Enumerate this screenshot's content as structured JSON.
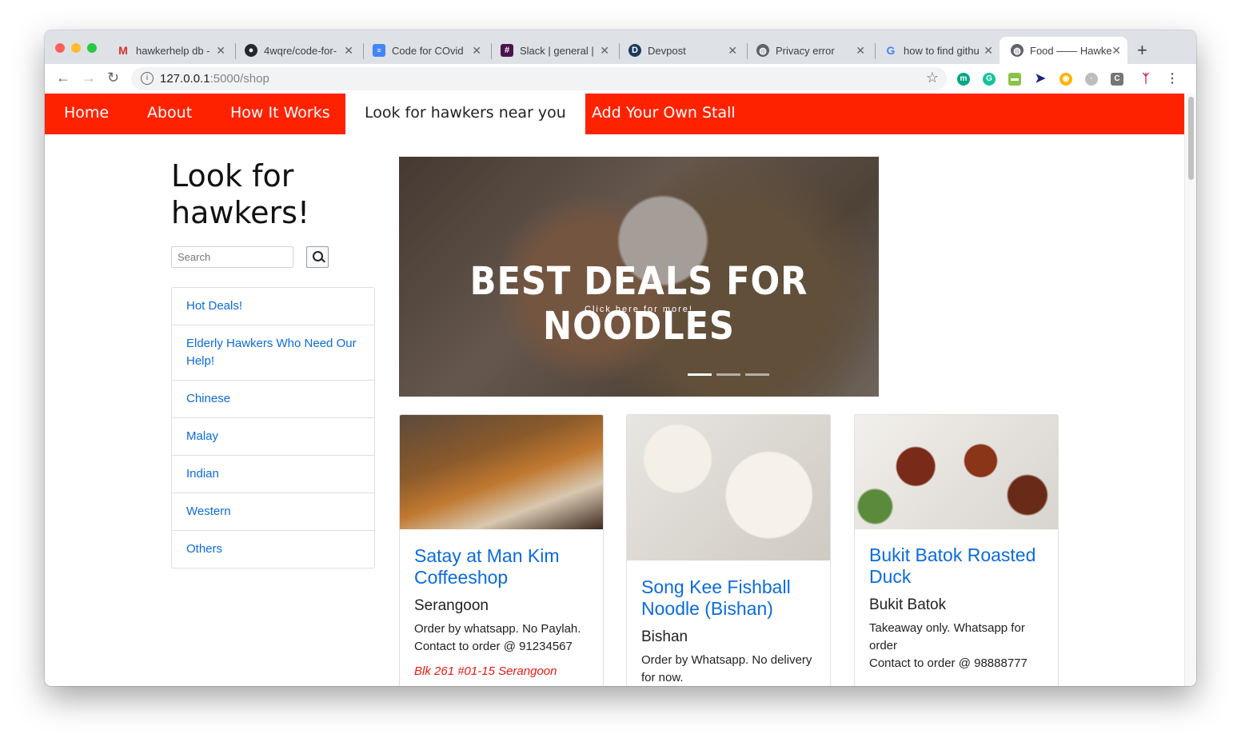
{
  "browser": {
    "tabs": [
      {
        "title": "hawkerhelp db -",
        "favicon": "gmail-icon"
      },
      {
        "title": "4wqre/code-for-",
        "favicon": "github-icon"
      },
      {
        "title": "Code for COvid",
        "favicon": "docs-icon"
      },
      {
        "title": "Slack | general |",
        "favicon": "slack-icon"
      },
      {
        "title": "Devpost",
        "favicon": "devpost-icon"
      },
      {
        "title": "Privacy error",
        "favicon": "globe-icon"
      },
      {
        "title": "how to find githu",
        "favicon": "google-icon"
      },
      {
        "title": "Food —— Hawke",
        "favicon": "globe-icon",
        "active": true
      }
    ],
    "url_host": "127.0.0.1",
    "url_path": ":5000/shop"
  },
  "site": {
    "nav": {
      "home": "Home",
      "about": "About",
      "how": "How It Works",
      "look": "Look for hawkers near you",
      "add": "Add Your Own Stall"
    },
    "heading": "Look for hawkers!",
    "search_placeholder": "Search",
    "categories": [
      "Hot Deals!",
      "Elderly Hawkers Who Need Our Help!",
      "Chinese",
      "Malay",
      "Indian",
      "Western",
      "Others"
    ],
    "carousel": {
      "title": "BEST DEALS FOR NOODLES",
      "subtitle": "Click here for more!",
      "slides": 3,
      "active_slide": 1
    },
    "cards": [
      {
        "title": "Satay at Man Kim Coffeeshop",
        "location": "Serangoon",
        "desc1": "Order by whatsapp. No Paylah.",
        "desc2": "Contact to order @ 91234567",
        "address": "Blk 261 #01-15 Serangoon"
      },
      {
        "title": "Song Kee Fishball Noodle (Bishan)",
        "location": "Bishan",
        "desc1": "Order by Whatsapp. No delivery for now."
      },
      {
        "title": "Bukit Batok Roasted Duck",
        "location": "Bukit Batok",
        "desc1": "Takeaway only. Whatsapp for order",
        "desc2": "Contact to order @ 98888777"
      }
    ]
  }
}
